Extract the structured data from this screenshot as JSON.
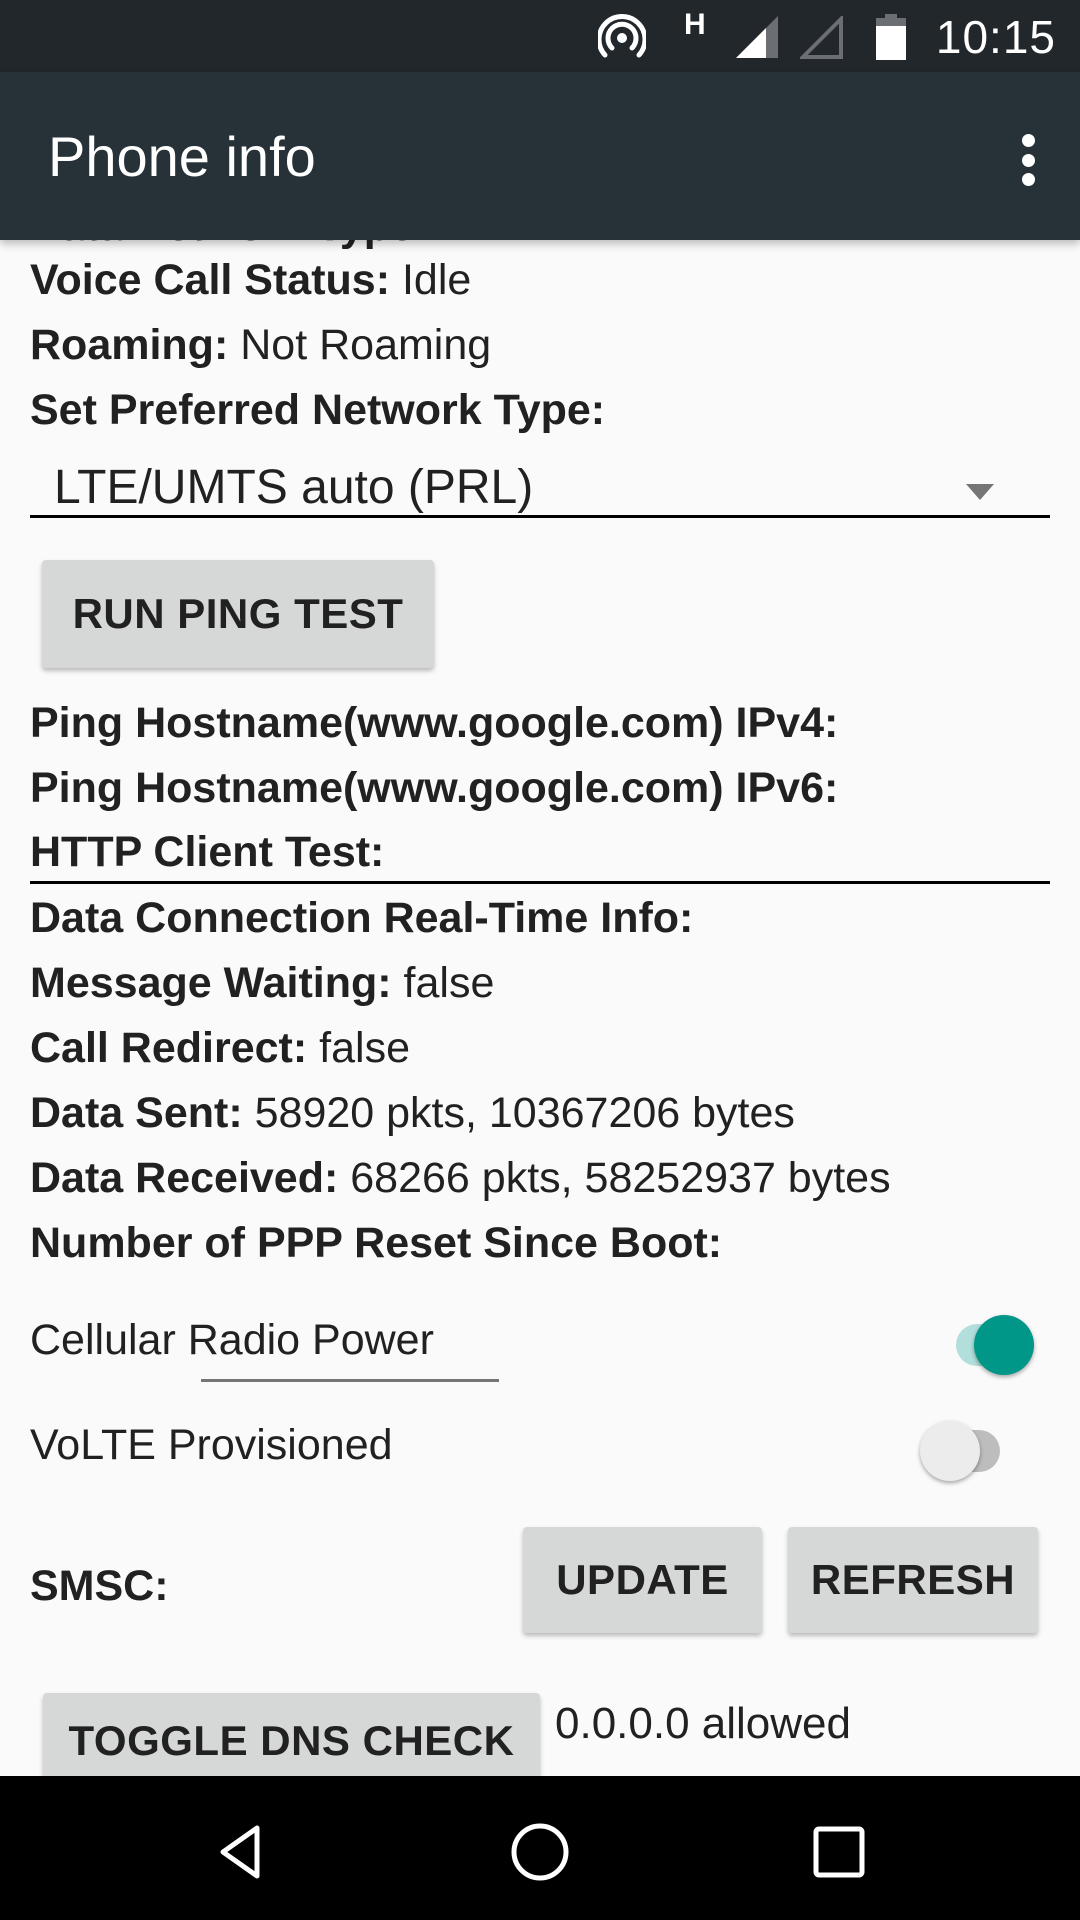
{
  "status_bar": {
    "time": "10:15",
    "network_indicator": "H",
    "icons": [
      "hotspot-icon",
      "network-type-h",
      "signal-strength-icon",
      "signal-empty-icon",
      "battery-icon"
    ]
  },
  "app_bar": {
    "title": "Phone info",
    "menu_icon": "overflow-menu-icon"
  },
  "info": {
    "cut_off_row_label": "Data Network Type:",
    "voice_call_status": {
      "label": "Voice Call Status:",
      "value": "Idle"
    },
    "roaming": {
      "label": "Roaming:",
      "value": "Not Roaming"
    },
    "preferred_network": {
      "label": "Set Preferred Network Type:",
      "selected": "LTE/UMTS auto (PRL)"
    },
    "run_ping_test_label": "RUN PING TEST",
    "ping_ipv4": {
      "label": "Ping Hostname(www.google.com) IPv4:",
      "value": ""
    },
    "ping_ipv6": {
      "label": "Ping Hostname(www.google.com) IPv6:",
      "value": ""
    },
    "http_client_test": {
      "label": "HTTP Client Test:",
      "value": ""
    },
    "data_connection_realtime": {
      "label": "Data Connection Real-Time Info:",
      "value": ""
    },
    "message_waiting": {
      "label": "Message Waiting:",
      "value": "false"
    },
    "call_redirect": {
      "label": "Call Redirect:",
      "value": "false"
    },
    "data_sent": {
      "label": "Data Sent:",
      "value": "58920 pkts, 10367206 bytes"
    },
    "data_received": {
      "label": "Data Received:",
      "value": "68266 pkts, 58252937 bytes"
    },
    "ppp_reset": {
      "label": "Number of PPP Reset Since Boot:",
      "value": ""
    }
  },
  "toggles": {
    "cellular_radio_power": {
      "label": "Cellular Radio Power",
      "on": true
    },
    "volte_provisioned": {
      "label": "VoLTE Provisioned",
      "on": false
    }
  },
  "smsc": {
    "label": "SMSC:",
    "value": "",
    "update_label": "UPDATE",
    "refresh_label": "REFRESH"
  },
  "dns": {
    "toggle_label": "TOGGLE DNS CHECK",
    "status": "0.0.0.0 allowed"
  },
  "colors": {
    "status_bar_bg": "#22272c",
    "app_bar_bg": "#263238",
    "accent": "#009688",
    "accent_track": "#b2dfdb",
    "page_bg": "#fafafa",
    "button_bg": "#d6d7d7"
  },
  "nav_bar": {
    "buttons": [
      "back-icon",
      "home-icon",
      "recents-icon"
    ]
  }
}
